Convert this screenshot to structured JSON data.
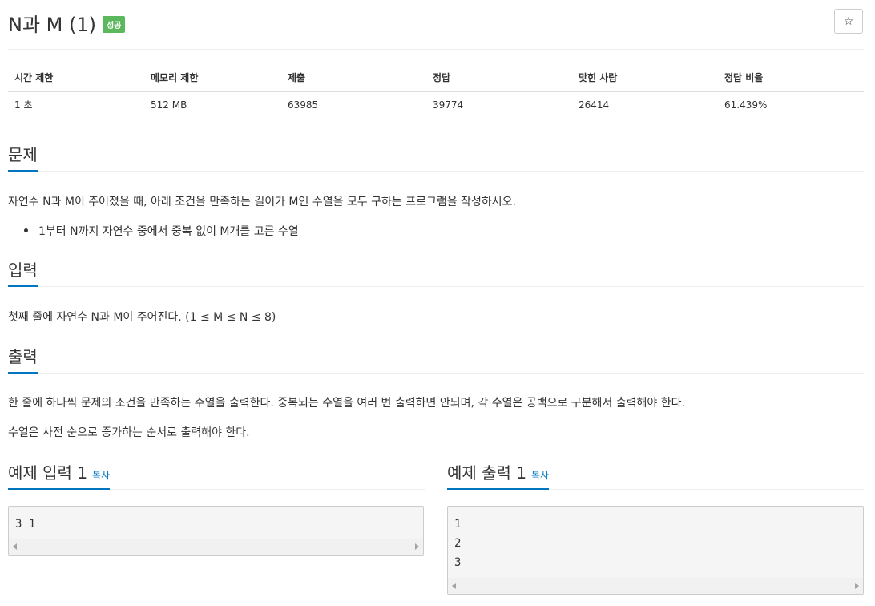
{
  "header": {
    "title": "N과 M (1)",
    "badge": "성공",
    "star": "☆"
  },
  "info_table": {
    "headers": [
      "시간 제한",
      "메모리 제한",
      "제출",
      "정답",
      "맞힌 사람",
      "정답 비율"
    ],
    "values": [
      "1 초",
      "512 MB",
      "63985",
      "39774",
      "26414",
      "61.439%"
    ]
  },
  "problem": {
    "heading": "문제",
    "text": "자연수 N과 M이 주어졌을 때, 아래 조건을 만족하는 길이가 M인 수열을 모두 구하는 프로그램을 작성하시오.",
    "bullets": [
      "1부터 N까지 자연수 중에서 중복 없이 M개를 고른 수열"
    ]
  },
  "input": {
    "heading": "입력",
    "text": "첫째 줄에 자연수 N과 M이 주어진다. (1 ≤ M ≤ N ≤ 8)"
  },
  "output": {
    "heading": "출력",
    "text1": "한 줄에 하나씩 문제의 조건을 만족하는 수열을 출력한다. 중복되는 수열을 여러 번 출력하면 안되며, 각 수열은 공백으로 구분해서 출력해야 한다.",
    "text2": "수열은 사전 순으로 증가하는 순서로 출력해야 한다."
  },
  "sample_input": {
    "heading": "예제 입력 1",
    "copy": "복사",
    "lines": [
      "3 1"
    ]
  },
  "sample_output": {
    "heading": "예제 출력 1",
    "copy": "복사",
    "lines": [
      "1",
      "2",
      "3"
    ]
  },
  "colors": {
    "accent": "#0076c0",
    "badge": "#5cb85c"
  }
}
